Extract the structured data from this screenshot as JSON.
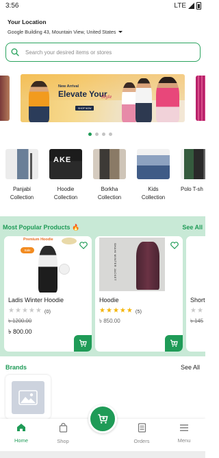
{
  "status_bar": {
    "time": "3:56",
    "network": "LTE"
  },
  "location": {
    "title": "Your Location",
    "address": "Google Building 43, Mountain View, United States"
  },
  "search": {
    "placeholder": "Search your desired items or stores"
  },
  "banner": {
    "kicker": "New Arrival",
    "headline": "Elevate Your",
    "script": "Style",
    "cta": "SHOP NOW",
    "dots": 4,
    "active_dot": 0
  },
  "categories": [
    {
      "line1": "Panjabi",
      "line2": "Collection"
    },
    {
      "line1": "Hoodie",
      "line2": "Collection"
    },
    {
      "line1": "Borkha",
      "line2": "Collection"
    },
    {
      "line1": "Kids",
      "line2": "Collection"
    },
    {
      "line1": "Polo T-sh",
      "line2": ""
    }
  ],
  "popular": {
    "title": "Most Popular Products 🔥",
    "see_all": "See All",
    "products": [
      {
        "name": "Ladis  Winter Hoodie",
        "rating": 0,
        "rating_count": "(0)",
        "old_price": "৳ 1200.00",
        "price": "৳ 800.00",
        "badge": "Premium Hoodie",
        "tag": "Sale"
      },
      {
        "name": "Hoodie",
        "rating": 5,
        "rating_count": "(5)",
        "price": "৳ 850.00",
        "jacket_text": "SHAHI WINTER JACKET"
      },
      {
        "name": "Short",
        "old_price": "৳ 145"
      }
    ]
  },
  "brands": {
    "title": "Brands",
    "see_all": "See All"
  },
  "bottom_nav": {
    "items": [
      {
        "label": "Home",
        "icon": "home-icon",
        "active": true
      },
      {
        "label": "Shop",
        "icon": "bag-icon",
        "active": false
      },
      {
        "label": "Orders",
        "icon": "orders-icon",
        "active": false
      },
      {
        "label": "Menu",
        "icon": "menu-icon",
        "active": false
      }
    ],
    "fab_icon": "cart-icon"
  },
  "colors": {
    "accent": "#1f9b57",
    "section_bg": "#c8e9d6",
    "star": "#f4b400"
  }
}
